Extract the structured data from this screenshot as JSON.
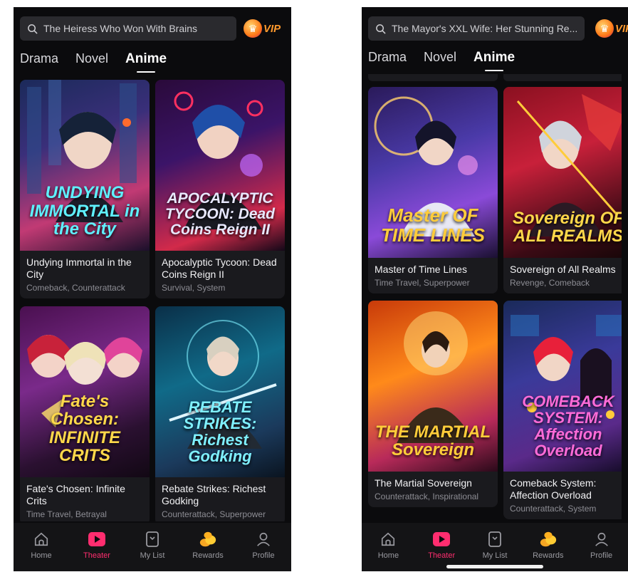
{
  "colors": {
    "accent": "#ff2d6f",
    "vip": "#ff9a2d",
    "background": "#0b0b0d"
  },
  "left": {
    "search": {
      "query": "The Heiress Who Won With Brains"
    },
    "vip_label": "VIP",
    "tabs": [
      {
        "label": "Drama",
        "active": false
      },
      {
        "label": "Novel",
        "active": false
      },
      {
        "label": "Anime",
        "active": true
      }
    ],
    "cards": [
      {
        "title": "Undying Immortal in the City",
        "genres": "Comeback, Counterattack",
        "art": "UNDYING IMMORTAL in the City"
      },
      {
        "title": "Apocalyptic Tycoon: Dead Coins Reign II",
        "genres": "Survival, System",
        "art": "APOCALYPTIC TYCOON: Dead Coins Reign II"
      },
      {
        "title": "Fate's Chosen: Infinite Crits",
        "genres": "Time Travel, Betrayal",
        "art": "Fate's Chosen: INFINITE CRITS"
      },
      {
        "title": "Rebate Strikes: Richest Godking",
        "genres": "Counterattack, Superpower",
        "art": "REBATE STRIKES: Richest Godking"
      }
    ],
    "nav": [
      {
        "label": "Home",
        "icon": "home-icon",
        "active": false
      },
      {
        "label": "Theater",
        "icon": "play-icon",
        "active": true
      },
      {
        "label": "My List",
        "icon": "bookmark-icon",
        "active": false
      },
      {
        "label": "Rewards",
        "icon": "coins-icon",
        "active": false
      },
      {
        "label": "Profile",
        "icon": "profile-icon",
        "active": false
      }
    ]
  },
  "right": {
    "search": {
      "query": "The Mayor's XXL Wife: Her Stunning Re..."
    },
    "vip_label": "VIP",
    "tabs": [
      {
        "label": "Drama",
        "active": false
      },
      {
        "label": "Novel",
        "active": false
      },
      {
        "label": "Anime",
        "active": true
      }
    ],
    "cards": [
      {
        "title": "Master of Time Lines",
        "genres": "Time Travel, Superpower",
        "art": "Master OF TIME LINES"
      },
      {
        "title": "Sovereign of All Realms",
        "genres": "Revenge, Comeback",
        "art": "Sovereign OF ALL REALMS"
      },
      {
        "title": "The Martial Sovereign",
        "genres": "Counterattack, Inspirational",
        "art": "THE MARTIAL Sovereign"
      },
      {
        "title": "Comeback System: Affection Overload",
        "genres": "Counterattack, System",
        "art": "COMEBACK SYSTEM: Affection Overload"
      }
    ],
    "nav": [
      {
        "label": "Home",
        "icon": "home-icon",
        "active": false
      },
      {
        "label": "Theater",
        "icon": "play-icon",
        "active": true
      },
      {
        "label": "My List",
        "icon": "bookmark-icon",
        "active": false
      },
      {
        "label": "Rewards",
        "icon": "coins-icon",
        "active": false
      },
      {
        "label": "Profile",
        "icon": "profile-icon",
        "active": false
      }
    ]
  }
}
